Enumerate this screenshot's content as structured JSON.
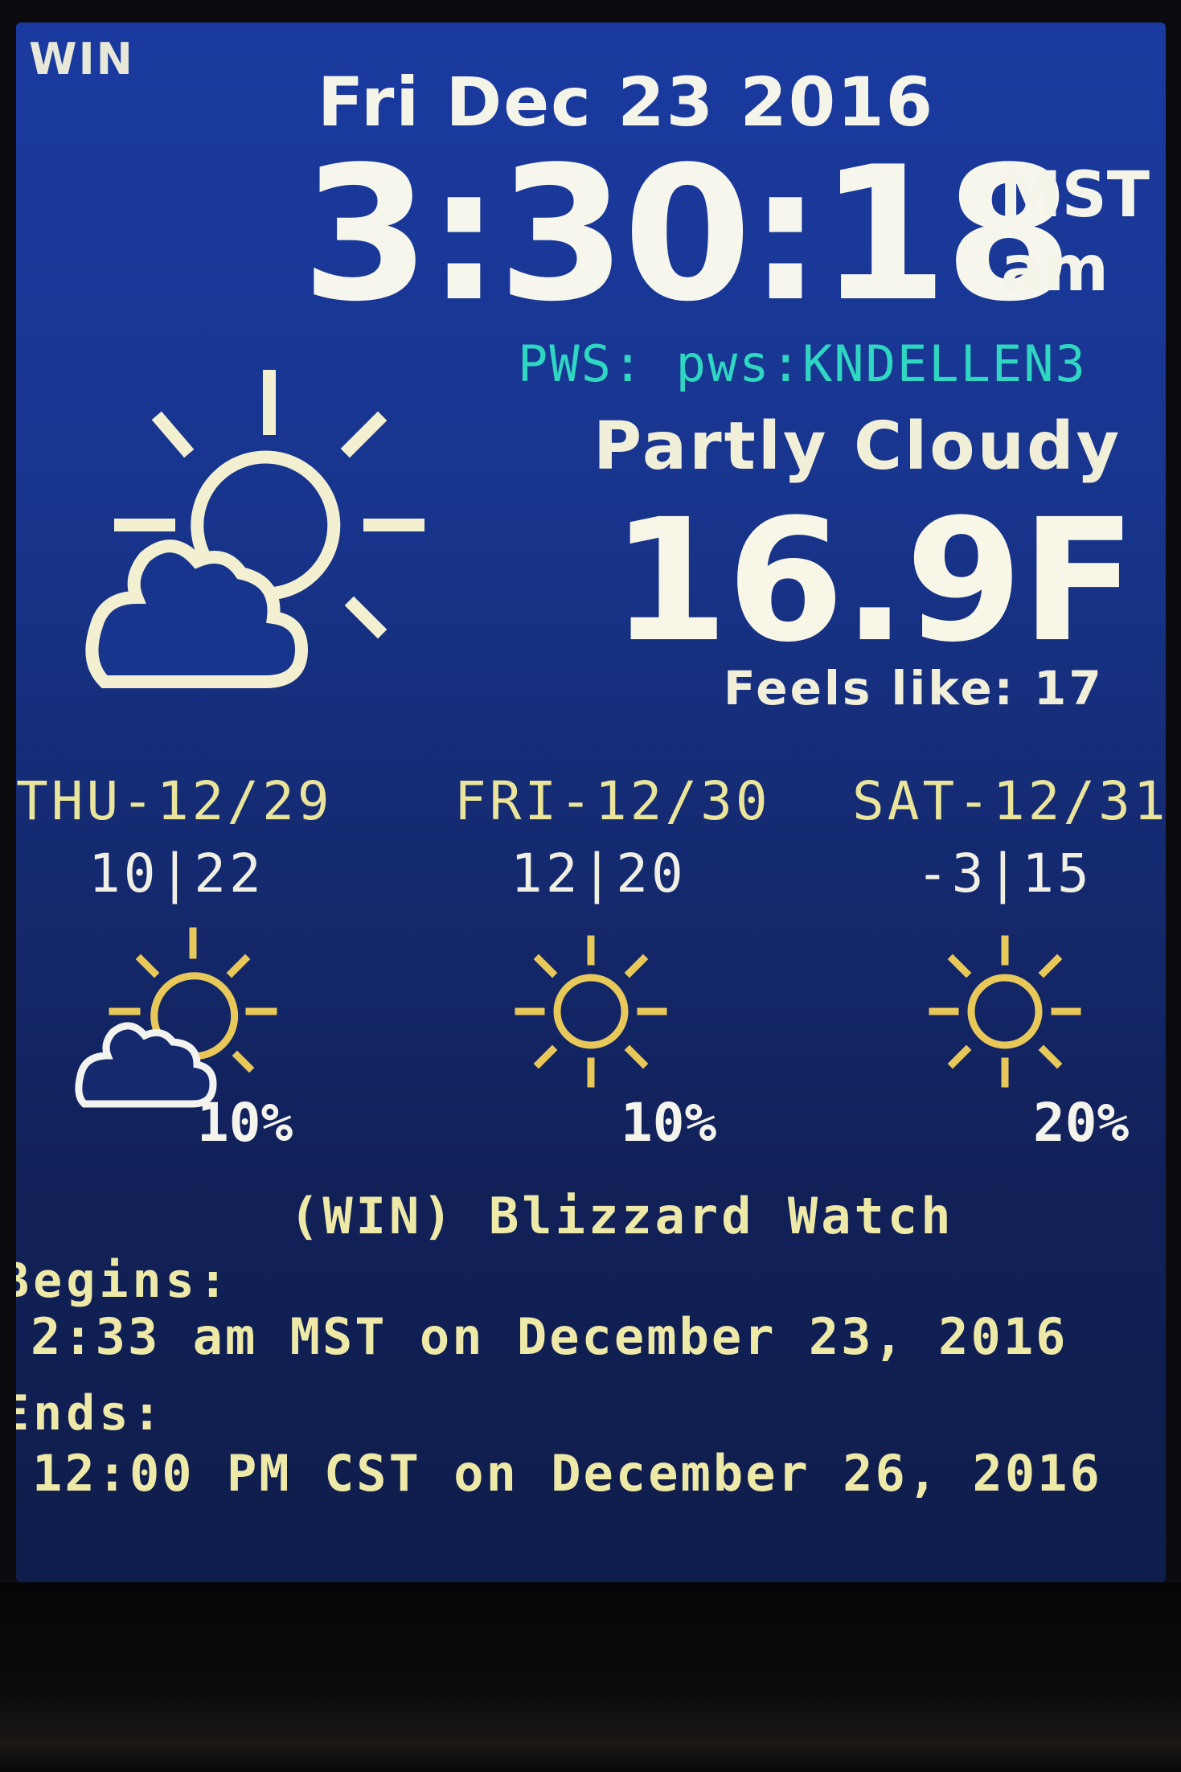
{
  "header": {
    "station_code": "WIN",
    "date": "Fri Dec 23 2016",
    "time": "3:30:18",
    "timezone": "MST",
    "ampm": "am"
  },
  "current": {
    "pws": "PWS: pws:KNDELLEN3",
    "condition": "Partly Cloudy",
    "temperature": "16.9F",
    "feels_like": "Feels like: 17",
    "icon": "partly-cloudy-icon"
  },
  "forecast": [
    {
      "day": "THU-12/29",
      "temps": "10|22",
      "precip": "10%",
      "icon": "partly-cloudy-icon"
    },
    {
      "day": "FRI-12/30",
      "temps": "12|20",
      "precip": "10%",
      "icon": "sunny-icon"
    },
    {
      "day": "SAT-12/31",
      "temps": "-3|15",
      "precip": "20%",
      "icon": "sunny-icon"
    }
  ],
  "alert": {
    "title": "(WIN) Blizzard Watch",
    "begins_label": "Begins:",
    "begins_value": "2:33 am MST on December 23, 2016",
    "ends_label": "Ends:",
    "ends_value": "12:00 PM CST on December 26, 2016"
  },
  "colors": {
    "background": "#18358e",
    "text": "#f4f4e8",
    "pws": "#2fd6c2",
    "forecast_day": "#eae59a",
    "alert": "#eee9a6",
    "sun_small": "#e9c85a",
    "sun_large": "#f2f0d0"
  }
}
